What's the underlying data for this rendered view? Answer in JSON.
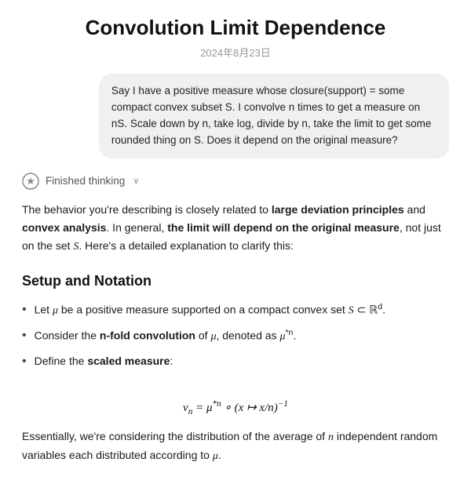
{
  "page": {
    "title": "Convolution Limit Dependence",
    "date": "2024年8月23日"
  },
  "user_message": {
    "text": "Say I have a positive measure whose closure(support) = some compact convex subset S.  I convolve n times to get a measure on nS. Scale down by n, take log, divide by n, take the limit to get some rounded thing on S.  Does it depend on the original measure?"
  },
  "ai": {
    "thinking_label": "Finished thinking",
    "chevron": "∨",
    "response_intro": "The behavior you're describing is closely related to ",
    "bold1": "large deviation principles",
    "response_and": " and ",
    "bold2": "convex analysis",
    "response_mid": ". In general, ",
    "bold3": "the limit will depend on the original measure",
    "response_end": ", not just on the set ",
    "math_S": "S",
    "response_tail": ". Here's a detailed explanation to clarify this:",
    "section_heading": "Setup and Notation",
    "bullets": [
      {
        "prefix": "Let ",
        "math": "μ",
        "suffix": " be a positive measure supported on a compact convex set ",
        "math2": "S ⊂ ℝ",
        "superscript": "d",
        "end": "."
      },
      {
        "prefix": "Consider the ",
        "bold": "n-fold convolution",
        "suffix": " of ",
        "math": "μ",
        "end": ", denoted as ",
        "math2": "μ",
        "superscript": "*n",
        "period": "."
      },
      {
        "prefix": "Define the ",
        "bold": "scaled measure",
        "suffix": ":"
      }
    ],
    "formula": "ν_n = μ*n ∘ (x ↦ x/n)⁻¹",
    "bottom_text": "Essentially, we're considering the distribution of the average of n independent random variables each distributed according to μ."
  }
}
